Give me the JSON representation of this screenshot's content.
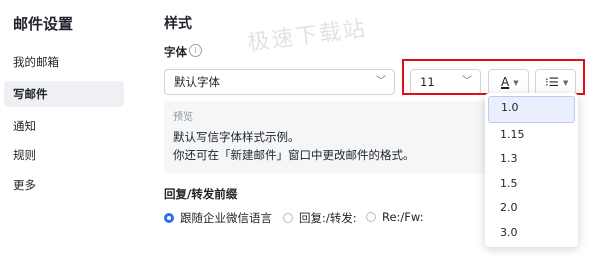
{
  "sidebar": {
    "title": "邮件设置",
    "items": [
      {
        "label": "我的邮箱",
        "active": false
      },
      {
        "label": "写邮件",
        "active": true
      },
      {
        "label": "通知",
        "active": false
      },
      {
        "label": "规则",
        "active": false
      },
      {
        "label": "更多",
        "active": false
      }
    ]
  },
  "main": {
    "section_title": "样式",
    "watermark": "极速下载站",
    "font": {
      "label": "字体",
      "info_icon": "ⓘ",
      "family_value": "默认字体",
      "size_value": "11",
      "color_glyph": "A",
      "line_height_glyph": "⁝☰"
    },
    "preview": {
      "label": "预览",
      "lines": [
        "默认写信字体样式示例。",
        "你还可在「新建邮件」窗口中更改邮件的格式。"
      ]
    },
    "reply_forward": {
      "title": "回复/转发前缀",
      "options": [
        {
          "label": "跟随企业微信语言",
          "checked": true
        },
        {
          "label": "回复:/转发:",
          "checked": false
        },
        {
          "label": "Re:/Fw:",
          "checked": false
        }
      ]
    }
  },
  "line_height_dropdown": {
    "options": [
      "1.0",
      "1.15",
      "1.3",
      "1.5",
      "2.0",
      "3.0"
    ],
    "selected": "1.0"
  },
  "colors": {
    "accent": "#2d6cf6",
    "highlight_box": "#e0101a",
    "active_nav_bg": "#eef0f3"
  }
}
